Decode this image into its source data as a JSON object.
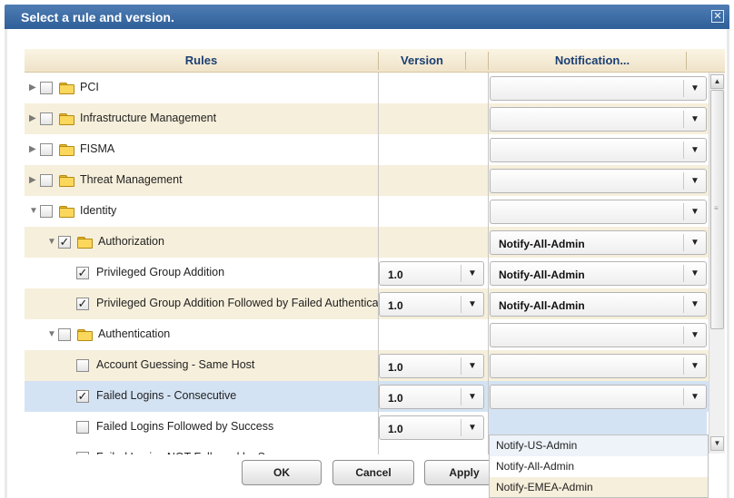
{
  "dialog": {
    "title": "Select a rule and version.",
    "close_symbol": "✕"
  },
  "columns": {
    "rules": "Rules",
    "version": "Version",
    "notification": "Notification..."
  },
  "rows": [
    {
      "label": "PCI",
      "indent": 0,
      "expander": "▶",
      "checked": false,
      "folder": true,
      "version": "",
      "notification": "",
      "striped": false
    },
    {
      "label": "Infrastructure Management",
      "indent": 0,
      "expander": "▶",
      "checked": false,
      "folder": true,
      "version": "",
      "notification": "",
      "striped": true
    },
    {
      "label": "FISMA",
      "indent": 0,
      "expander": "▶",
      "checked": false,
      "folder": true,
      "version": "",
      "notification": "",
      "striped": false
    },
    {
      "label": "Threat Management",
      "indent": 0,
      "expander": "▶",
      "checked": false,
      "folder": true,
      "version": "",
      "notification": "",
      "striped": true
    },
    {
      "label": "Identity",
      "indent": 0,
      "expander": "▼",
      "checked": false,
      "folder": true,
      "version": "",
      "notification": "",
      "striped": false
    },
    {
      "label": "Authorization",
      "indent": 1,
      "expander": "▼",
      "checked": true,
      "folder": true,
      "version": "",
      "notification": "Notify-All-Admin",
      "striped": true
    },
    {
      "label": "Privileged Group Addition",
      "indent": 2,
      "expander": "",
      "checked": true,
      "folder": false,
      "version": "1.0",
      "notification": "Notify-All-Admin",
      "striped": false
    },
    {
      "label": "Privileged Group Addition Followed by Failed Authentication",
      "indent": 2,
      "expander": "",
      "checked": true,
      "folder": false,
      "version": "1.0",
      "notification": "Notify-All-Admin",
      "striped": true
    },
    {
      "label": "Authentication",
      "indent": 1,
      "expander": "▼",
      "checked": false,
      "folder": true,
      "version": "",
      "notification": "",
      "striped": false
    },
    {
      "label": "Account Guessing - Same Host",
      "indent": 2,
      "expander": "",
      "checked": false,
      "folder": false,
      "version": "1.0",
      "notification": "",
      "striped": true
    },
    {
      "label": "Failed Logins - Consecutive",
      "indent": 2,
      "expander": "",
      "checked": true,
      "folder": false,
      "version": "1.0",
      "notification": "",
      "striped": false,
      "selected": true
    },
    {
      "label": "Failed Logins Followed by Success",
      "indent": 2,
      "expander": "",
      "checked": false,
      "folder": false,
      "version": "1.0",
      "notification": "",
      "striped": false
    },
    {
      "label": "Failed Logins NOT Followed by Success",
      "indent": 2,
      "expander": "",
      "checked": false,
      "folder": false,
      "version": "",
      "notification": "",
      "striped": false
    }
  ],
  "dropdown_options": [
    "Notify-US-Admin",
    "Notify-All-Admin",
    "Notify-EMEA-Admin"
  ],
  "buttons": {
    "ok": "OK",
    "cancel": "Cancel",
    "apply": "Apply"
  },
  "colors": {
    "title_bar": "#3a6ba5",
    "header_text": "#1c3f72",
    "stripe": "#f6efdb",
    "selected_row": "#d4e3f4"
  }
}
